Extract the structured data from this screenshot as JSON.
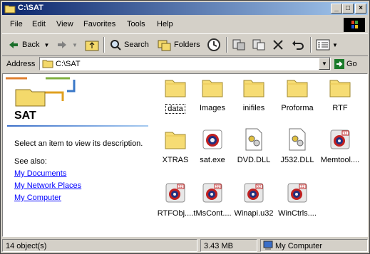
{
  "window": {
    "title": "C:\\SAT"
  },
  "menu": [
    "File",
    "Edit",
    "View",
    "Favorites",
    "Tools",
    "Help"
  ],
  "toolbar": {
    "back": "Back",
    "search": "Search",
    "folders": "Folders"
  },
  "address": {
    "label": "Address",
    "value": "C:\\SAT",
    "go": "Go"
  },
  "left_pane": {
    "title": "SAT",
    "description": "Select an item to view its description.",
    "see_also": "See also:",
    "links": [
      "My Documents",
      "My Network Places",
      "My Computer"
    ]
  },
  "files": [
    {
      "name": "data",
      "icon": "folder-icon"
    },
    {
      "name": "Images",
      "icon": "folder-icon"
    },
    {
      "name": "inifiles",
      "icon": "folder-icon"
    },
    {
      "name": "Proforma",
      "icon": "folder-icon"
    },
    {
      "name": "RTF",
      "icon": "folder-icon"
    },
    {
      "name": "XTRAS",
      "icon": "folder-icon"
    },
    {
      "name": "sat.exe",
      "icon": "exe-icon"
    },
    {
      "name": "DVD.DLL",
      "icon": "dll-icon"
    },
    {
      "name": "J532.DLL",
      "icon": "dll-icon"
    },
    {
      "name": "Memtool....",
      "icon": "u32-icon"
    },
    {
      "name": "RTFObj....",
      "icon": "u32-icon"
    },
    {
      "name": "tMsCont....",
      "icon": "u32-icon"
    },
    {
      "name": "Winapi.u32",
      "icon": "u32-icon"
    },
    {
      "name": "WinCtrls....",
      "icon": "u32-icon"
    }
  ],
  "status": {
    "objects": "14 object(s)",
    "size": "3.43 MB",
    "location": "My Computer"
  }
}
